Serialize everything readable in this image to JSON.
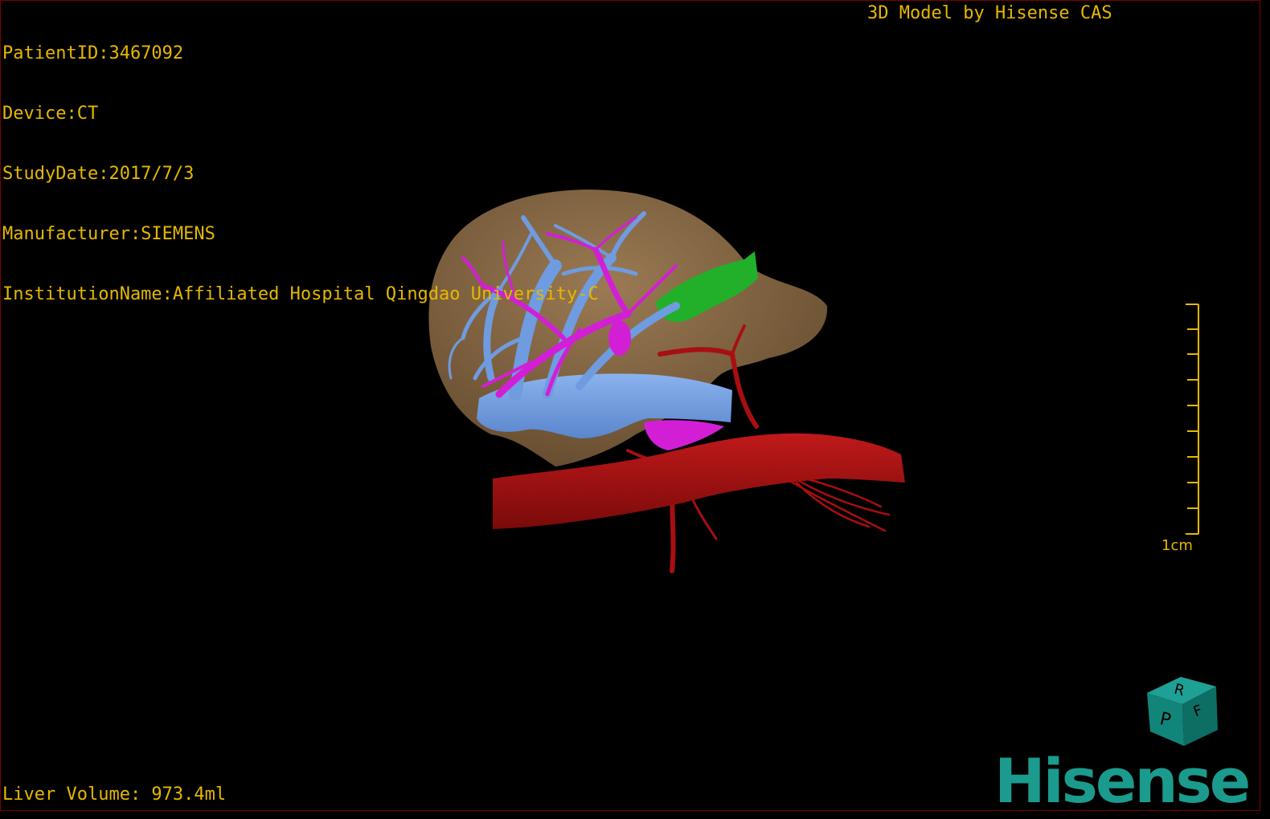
{
  "patient_info": {
    "patient_id": "PatientID:3467092",
    "device": "Device:CT",
    "study_date": "StudyDate:2017/7/3",
    "manufacturer": "Manufacturer:SIEMENS",
    "institution": "InstitutionName:Affiliated Hospital Qingdao University-C"
  },
  "model_credit": "3D Model by Hisense CAS",
  "liver_volume": "Liver Volume: 973.4ml",
  "scale_bar": {
    "label": "1cm"
  },
  "orientation_cube": {
    "face_top": "R",
    "face_front": "P",
    "face_right": "F"
  },
  "logo_text": "Hisense",
  "colors": {
    "overlay_text": "#e6b800",
    "liver": "#8c6a45",
    "hepatic_vein": "#6f9be0",
    "portal_vein": "#d21fd6",
    "artery": "#a80f10",
    "gallbladder": "#22b02a",
    "logo": "#1a9b8d"
  },
  "icons": {
    "cube": "orientation-cube-icon",
    "logo": "hisense-logo"
  }
}
